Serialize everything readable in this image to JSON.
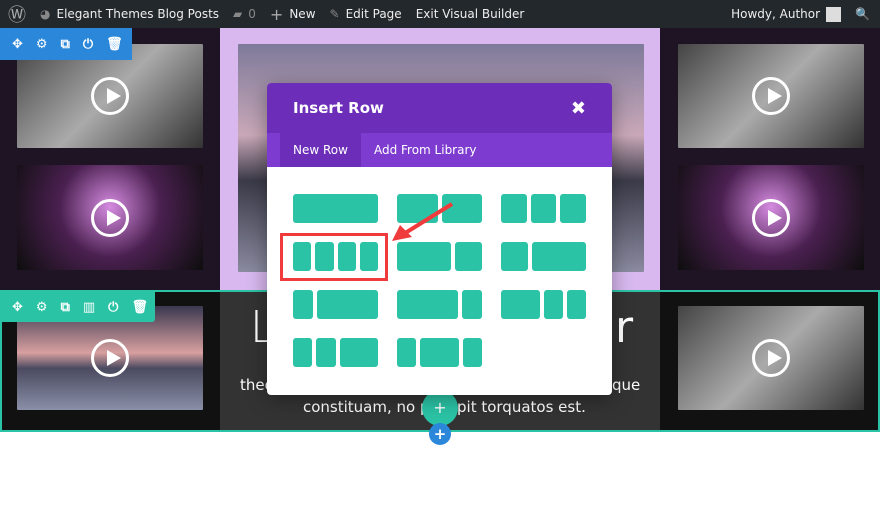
{
  "adminbar": {
    "site": "Elegant Themes Blog Posts",
    "comments": "0",
    "new": "New",
    "edit": "Edit Page",
    "exit": "Exit Visual Builder",
    "howdy": "Howdy, Author"
  },
  "page": {
    "heading_left": "L",
    "heading_right": "r",
    "text_left": "theo",
    "text_right": "que",
    "text_line2a": "constituam, no p",
    "text_line2b": "pit torquatos est."
  },
  "modal": {
    "title": "Insert Row",
    "tabs": [
      {
        "label": "New Row",
        "active": true
      },
      {
        "label": "Add From Library",
        "active": false
      }
    ],
    "layouts": [
      [
        1
      ],
      [
        0.5,
        0.5
      ],
      [
        0.333,
        0.333,
        0.333
      ],
      [
        0.25,
        0.25,
        0.25,
        0.25
      ],
      [
        0.667,
        0.333
      ],
      [
        0.333,
        0.667
      ],
      [
        0.25,
        0.75
      ],
      [
        0.75,
        0.25
      ],
      [
        0.5,
        0.25,
        0.25
      ],
      [
        0.25,
        0.25,
        0.5
      ],
      [
        0.25,
        0.5,
        0.25
      ]
    ],
    "highlighted_layout": 3
  },
  "colors": {
    "admin": "#23282d",
    "purple": "#6c2eb9",
    "teal": "#2bc3a5",
    "blue": "#2b87da",
    "highlight": "#ef3b3b"
  }
}
